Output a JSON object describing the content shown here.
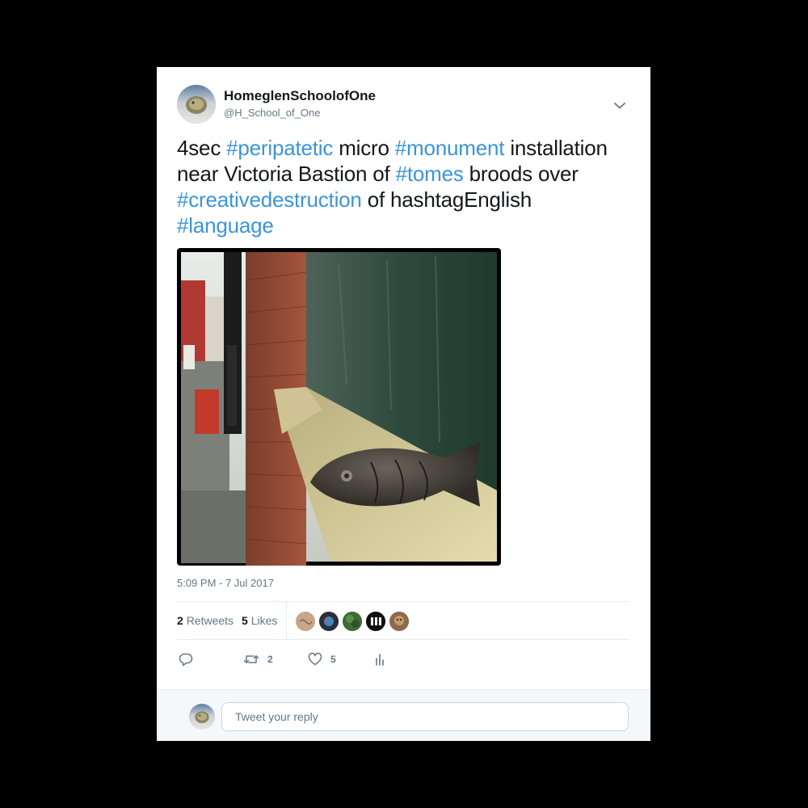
{
  "user": {
    "name": "HomeglenSchoolofOne",
    "handle": "@H_School_of_One"
  },
  "tweet": {
    "segments": [
      {
        "text": "4sec ",
        "tag": false
      },
      {
        "text": "#peripatetic",
        "tag": true
      },
      {
        "text": " micro ",
        "tag": false
      },
      {
        "text": "#monument",
        "tag": true
      },
      {
        "text": " installation near Victoria Bastion of ",
        "tag": false
      },
      {
        "text": "#tomes",
        "tag": true
      },
      {
        "text": " broods over ",
        "tag": false
      },
      {
        "text": "#creativedestruction",
        "tag": true
      },
      {
        "text": " of hashtagEnglish ",
        "tag": false
      },
      {
        "text": "#language",
        "tag": true
      }
    ],
    "timestamp": "5:09 PM - 7 Jul 2017"
  },
  "stats": {
    "retweets_count": "2",
    "retweets_label": "Retweets",
    "likes_count": "5",
    "likes_label": "Likes"
  },
  "actions": {
    "reply_icon": "reply-icon",
    "retweet_icon": "retweet-icon",
    "retweet_count": "2",
    "like_icon": "heart-icon",
    "like_count": "5",
    "analytics_icon": "analytics-icon"
  },
  "reply": {
    "placeholder": "Tweet your reply"
  },
  "colors": {
    "link": "#3b94d9",
    "text": "#14171a",
    "muted": "#657786",
    "divider": "#e6ecf0"
  }
}
